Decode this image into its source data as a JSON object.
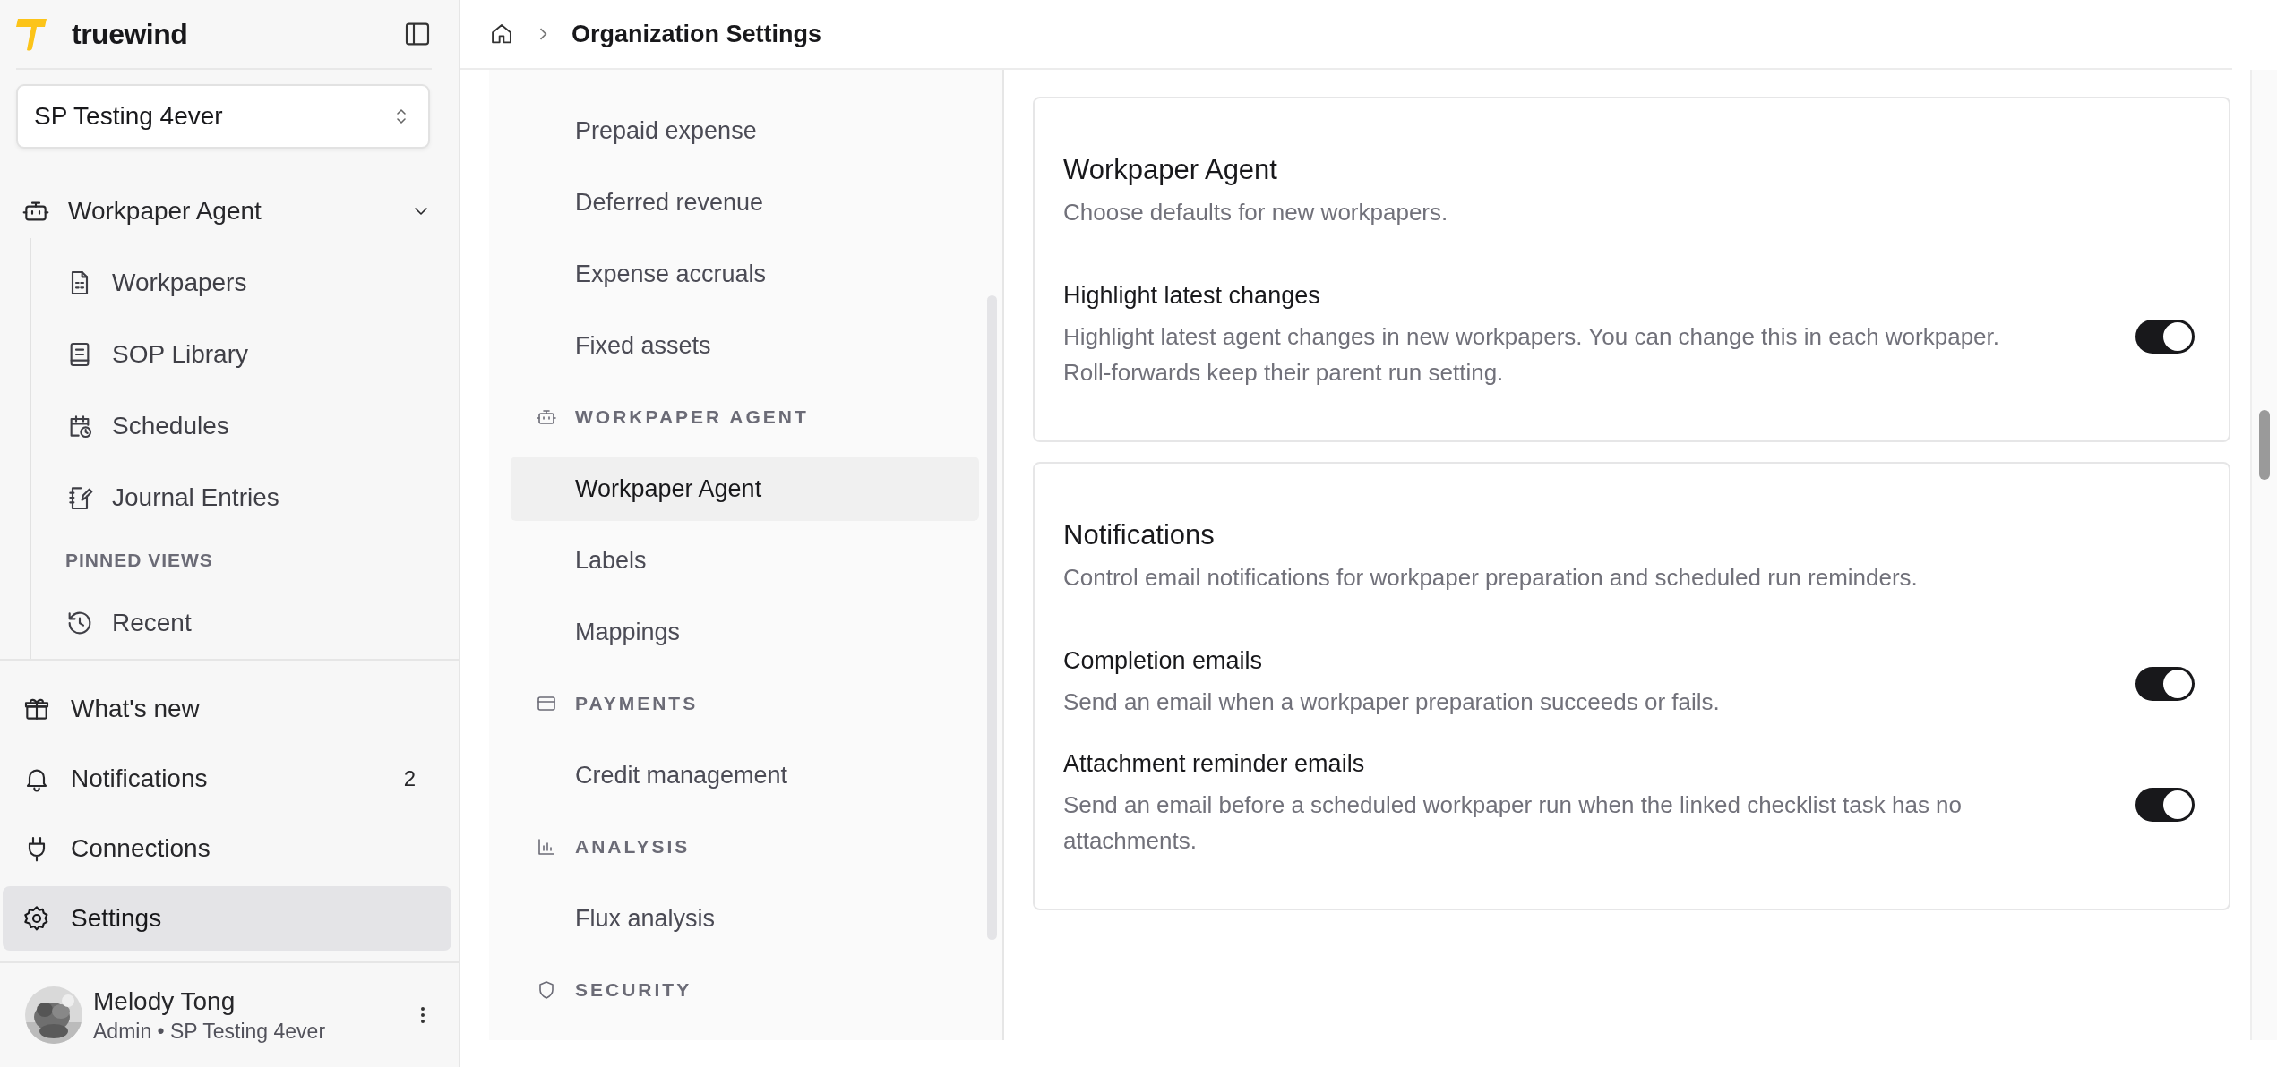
{
  "app": {
    "name": "truewind"
  },
  "org_selector": {
    "value": "SP Testing 4ever"
  },
  "sidebar": {
    "items": [
      {
        "label": "Workpaper Agent",
        "expanded": true,
        "children": [
          {
            "kind": "link",
            "label": "Workpapers",
            "selected": false
          },
          {
            "kind": "link",
            "label": "SOP Library",
            "selected": false
          },
          {
            "kind": "link",
            "label": "Schedules",
            "selected": false
          },
          {
            "kind": "link",
            "label": "Journal Entries",
            "selected": false
          },
          {
            "kind": "section",
            "label": "PINNED VIEWS"
          },
          {
            "kind": "link",
            "label": "Recent",
            "selected": false
          }
        ]
      }
    ]
  },
  "footer_nav": [
    {
      "label": "What's new",
      "selected": false
    },
    {
      "label": "Notifications",
      "badge": "2",
      "selected": false
    },
    {
      "label": "Connections",
      "selected": false
    },
    {
      "label": "Settings",
      "selected": true
    }
  ],
  "user": {
    "name": "Melody Tong",
    "subtitle": "Admin • SP Testing 4ever"
  },
  "breadcrumb": {
    "title": "Organization Settings"
  },
  "settings_nav": [
    {
      "kind": "item",
      "label": "Prepaid expense",
      "selected": false
    },
    {
      "kind": "item",
      "label": "Deferred revenue",
      "selected": false
    },
    {
      "kind": "item",
      "label": "Expense accruals",
      "selected": false
    },
    {
      "kind": "item",
      "label": "Fixed assets",
      "selected": false
    },
    {
      "kind": "section",
      "label": "WORKPAPER AGENT"
    },
    {
      "kind": "item",
      "label": "Workpaper Agent",
      "selected": true
    },
    {
      "kind": "item",
      "label": "Labels",
      "selected": false
    },
    {
      "kind": "item",
      "label": "Mappings",
      "selected": false
    },
    {
      "kind": "section",
      "label": "PAYMENTS"
    },
    {
      "kind": "item",
      "label": "Credit management",
      "selected": false
    },
    {
      "kind": "section",
      "label": "ANALYSIS"
    },
    {
      "kind": "item",
      "label": "Flux analysis",
      "selected": false
    },
    {
      "kind": "section",
      "label": "SECURITY"
    }
  ],
  "cards": [
    {
      "title": "Workpaper Agent",
      "description": "Choose defaults for new workpapers.",
      "settings": [
        {
          "label": "Highlight latest changes",
          "description": "Highlight latest agent changes in new workpapers. You can change this in each workpaper. Roll-forwards keep their parent run setting.",
          "on": true
        }
      ]
    },
    {
      "title": "Notifications",
      "description": "Control email notifications for workpaper preparation and scheduled run reminders.",
      "settings": [
        {
          "label": "Completion emails",
          "description": "Send an email when a workpaper preparation succeeds or fails.",
          "on": true
        },
        {
          "label": "Attachment reminder emails",
          "description": "Send an email before a scheduled workpaper run when the linked checklist task has no attachments.",
          "on": true
        }
      ]
    }
  ]
}
